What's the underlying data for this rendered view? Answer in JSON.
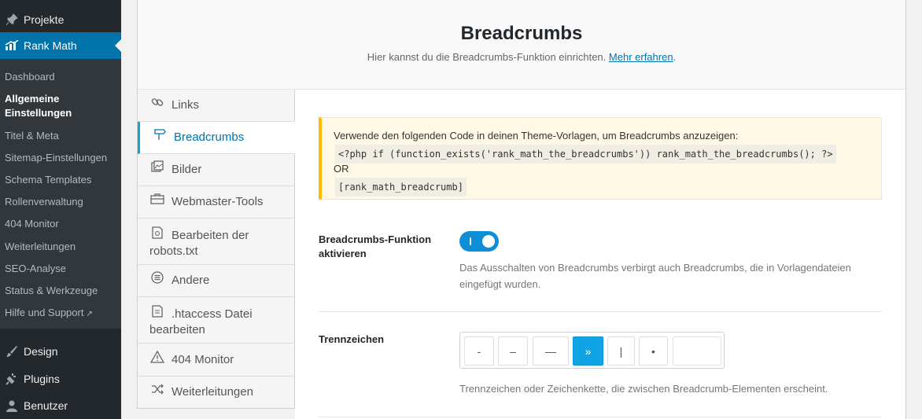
{
  "adminmenu": {
    "projekte": "Projekte",
    "rankmath": "Rank Math",
    "submenu": [
      "Dashboard",
      "Allgemeine Einstellungen",
      "Titel & Meta",
      "Sitemap-Einstellungen",
      "Schema Templates",
      "Rollenverwaltung",
      "404 Monitor",
      "Weiterleitungen",
      "SEO-Analyse",
      "Status & Werkzeuge",
      "Hilfe und Support"
    ],
    "design": "Design",
    "plugins": "Plugins",
    "benutzer": "Benutzer"
  },
  "header": {
    "title": "Breadcrumbs",
    "description": "Hier kannst du die Breadcrumbs-Funktion einrichten.",
    "link": "Mehr erfahren",
    "period": "."
  },
  "tabs": [
    {
      "label": "Links",
      "icon": "link-icon"
    },
    {
      "label": "Breadcrumbs",
      "icon": "signpost-icon"
    },
    {
      "label": "Bilder",
      "icon": "image-icon"
    },
    {
      "label": "Webmaster-Tools",
      "icon": "toolbox-icon"
    },
    {
      "label": "Bearbeiten der robots.txt",
      "icon": "file-icon"
    },
    {
      "label": "Andere",
      "icon": "menu-circle-icon"
    },
    {
      "label": ".htaccess Datei bearbeiten",
      "icon": "document-icon"
    },
    {
      "label": "404 Monitor",
      "icon": "warning-icon"
    },
    {
      "label": "Weiterleitungen",
      "icon": "shuffle-icon"
    }
  ],
  "notice": {
    "intro": "Verwende den folgenden Code in deinen Theme-Vorlagen, um Breadcrumbs anzuzeigen:",
    "code1": "<?php if (function_exists('rank_math_the_breadcrumbs')) rank_math_the_breadcrumbs(); ?>",
    "or": "OR",
    "code2": "[rank_math_breadcrumb]"
  },
  "enable_field": {
    "label": "Breadcrumbs-Funktion aktivieren",
    "enabled": true,
    "desc_line1": "Das Ausschalten von Breadcrumbs verbirgt auch Breadcrumbs, die in Vorlagendateien",
    "desc_line2": "eingefügt wurden."
  },
  "separator_field": {
    "label": "Trennzeichen",
    "options": [
      "-",
      "–",
      "—",
      "»",
      "|",
      "•",
      ""
    ],
    "selected": "»",
    "description": "Trennzeichen oder Zeichenkette, die zwischen Breadcrumb-Elementen erscheint."
  },
  "colors": {
    "admin_bg": "#23282d",
    "accent": "#0073aa",
    "toggle_on": "#0e8ed6",
    "notice_border": "#ffb900"
  }
}
